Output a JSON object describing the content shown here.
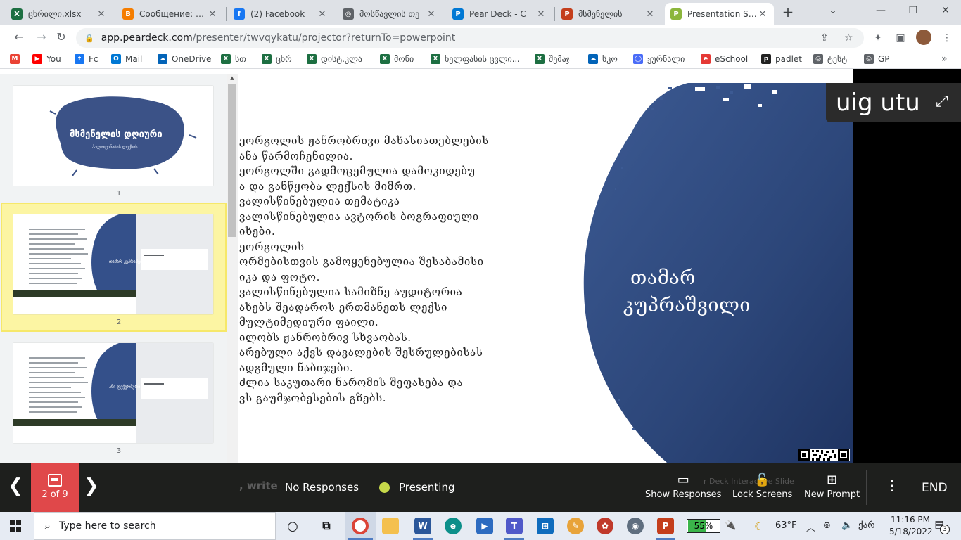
{
  "browser": {
    "tabs": [
      {
        "title": "ცხრილი.xlsx",
        "icon": "excel-icon",
        "color": "#1d6f42",
        "letter": "X"
      },
      {
        "title": "Сообщение: ред",
        "icon": "blogger-icon",
        "color": "#f57d00",
        "letter": "B"
      },
      {
        "title": "(2) Facebook",
        "icon": "facebook-icon",
        "color": "#1877f2",
        "letter": "f"
      },
      {
        "title": "მოსწავლის თე",
        "icon": "globe-icon",
        "color": "#5f6368",
        "letter": "◎"
      },
      {
        "title": "Pear Deck - C",
        "icon": "peardeck-icon",
        "color": "#0078d4",
        "letter": "P"
      },
      {
        "title": "მსმენელის",
        "icon": "powerpoint-icon",
        "color": "#c43e1c",
        "letter": "P"
      },
      {
        "title": "Presentation Sess",
        "icon": "peardeck-icon",
        "color": "#8cb63c",
        "letter": "P"
      }
    ],
    "url_host": "app.peardeck.com",
    "url_path": "/presenter/twvqykatu/projector?returnTo=powerpoint",
    "bookmarks": [
      {
        "label": "",
        "icon": "gmail-icon",
        "color": "#ea4335",
        "letter": "M"
      },
      {
        "label": "You",
        "icon": "youtube-icon",
        "color": "#ff0000",
        "letter": "▶"
      },
      {
        "label": "Fc",
        "icon": "facebook-icon",
        "color": "#1877f2",
        "letter": "f"
      },
      {
        "label": "Mail",
        "icon": "outlook-icon",
        "color": "#0078d4",
        "letter": "O"
      },
      {
        "label": "OneDrive",
        "icon": "onedrive-icon",
        "color": "#0364b8",
        "letter": "☁"
      },
      {
        "label": "სთ",
        "icon": "excel-icon",
        "color": "#1d6f42",
        "letter": "X"
      },
      {
        "label": "ცხრ",
        "icon": "excel-icon",
        "color": "#1d6f42",
        "letter": "X"
      },
      {
        "label": "დისტ.კლა",
        "icon": "excel-icon",
        "color": "#1d6f42",
        "letter": "X"
      },
      {
        "label": "მონი",
        "icon": "excel-icon",
        "color": "#1d6f42",
        "letter": "X"
      },
      {
        "label": "ხელფასის ცვლი...",
        "icon": "excel-icon",
        "color": "#1d6f42",
        "letter": "X"
      },
      {
        "label": "შემაჯ",
        "icon": "excel-icon",
        "color": "#1d6f42",
        "letter": "X"
      },
      {
        "label": "სკო",
        "icon": "onedrive-icon",
        "color": "#0364b8",
        "letter": "☁"
      },
      {
        "label": "ჟურნალი",
        "icon": "journal-icon",
        "color": "#4a6cf7",
        "letter": "◯"
      },
      {
        "label": "eSchool",
        "icon": "eschool-icon",
        "color": "#e53935",
        "letter": "e"
      },
      {
        "label": "padlet",
        "icon": "padlet-icon",
        "color": "#222222",
        "letter": "p"
      },
      {
        "label": "ტესტ",
        "icon": "globe-icon",
        "color": "#5f6368",
        "letter": "◎"
      },
      {
        "label": "GP",
        "icon": "globe-icon",
        "color": "#5f6368",
        "letter": "◎"
      }
    ]
  },
  "sidebar": {
    "thumbnails": [
      {
        "number": "1",
        "title": "მსმენელის დღიური",
        "subtitle": "ჰალოფანაბის ლექსის"
      },
      {
        "number": "2",
        "title": "თამარ კუპრაშვილი",
        "selected": true
      },
      {
        "number": "3",
        "title": "ანი ფეჭერმური"
      }
    ]
  },
  "slide": {
    "lines": [
      "ეორგოლის  ჟანრობრივი მახასიათებლების",
      "ანა წარმოჩენილია.",
      "ეორგოლში გადმოცემულია  დამოკიდებუ",
      "ა  და განწყობა ლექსის მიმრთ.",
      "ვალისწინებულია თემატიკა",
      "ვალისწინებულია  ავტორის ბოგრაფიული",
      "იხები.",
      "ეორგოლის",
      "ორმებისთვის გამოყენებულია შესაბამისი",
      "იკა და ფოტო.",
      "ვალისწინებულია სამიზნე აუდიტორია",
      "ახებს შეადაროს ერთმანეთს ლექსი",
      "მულტიმედიური ფაილი.",
      "ილობს ჟანრობრივ სხვაობას.",
      "არებული აქვს დავალების შესრულებისას",
      "ადგმული ნაბიჯები.",
      "ძლია საკუთარი ნარომის შეფასება და",
      "ვს გაუმჯობესების გზებს."
    ],
    "title_line1": "თამარ",
    "title_line2": "კუპრაშვილი"
  },
  "join_code": "uig utu",
  "controls": {
    "slide_count": "2 of 9",
    "ghost_text": ", write",
    "responses": "No Responses",
    "presenting": "Presenting",
    "ghost_text2": "r Deck Interactive Slide",
    "show_responses": "Show Responses",
    "lock_screens": "Lock Screens",
    "new_prompt": "New Prompt",
    "end": "END"
  },
  "taskbar": {
    "search_placeholder": "Type here to search",
    "battery": "55%",
    "battery_fraction": 0.55,
    "temperature": "63°F",
    "language": "ქარ",
    "time": "11:16 PM",
    "date": "5/18/2022",
    "notifications": "3"
  }
}
